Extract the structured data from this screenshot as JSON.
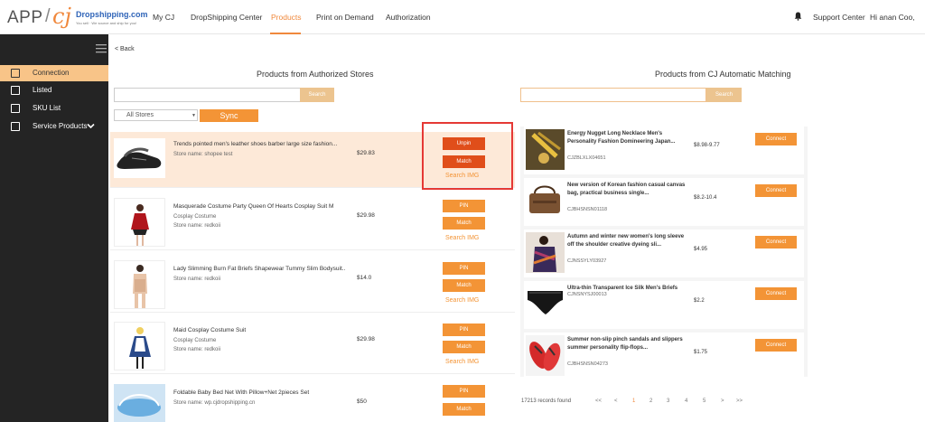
{
  "logo": {
    "app": "APP",
    "slash": "/",
    "cj": "cj",
    "brand": "Dropshipping.com",
    "tagline": "You sell · We source and ship for you!"
  },
  "nav": {
    "items": [
      "My CJ",
      "DropShipping Center",
      "Products",
      "Print on Demand",
      "Authorization"
    ],
    "support": "Support Center",
    "greeting": "Hi anan Coo,"
  },
  "sidebar": {
    "items": [
      "Connection",
      "Listed",
      "SKU List",
      "Service Products"
    ]
  },
  "back": "< Back",
  "left": {
    "title": "Products from Authorized Stores",
    "search_placeholder": "",
    "search_label": "Search",
    "store_select": "All Stores",
    "sync_label": "Sync",
    "rows": [
      {
        "title": "Trends pointed men's leather shoes barber large size fashion...",
        "sub": "",
        "store": "Store name: shopee test",
        "price": "$29.83",
        "btn1": "Unpin",
        "btn2": "Match",
        "img": "Search IMG"
      },
      {
        "title": "Masquerade Costume Party Queen Of Hearts Cosplay Suit M",
        "sub": "Cosplay Costume",
        "store": "Store name: redkoii",
        "price": "$29.98",
        "btn1": "PIN",
        "btn2": "Match",
        "img": "Search IMG"
      },
      {
        "title": "Lady Slimming Burn Fat Briefs Shapewear Tummy Slim Bodysuit...",
        "sub": "",
        "store": "Store name: redkoii",
        "price": "$14.0",
        "btn1": "PIN",
        "btn2": "Match",
        "img": "Search IMG"
      },
      {
        "title": "Maid Cosplay Costume Suit",
        "sub": "Cosplay Costume",
        "store": "Store name: redkoii",
        "price": "$29.98",
        "btn1": "PIN",
        "btn2": "Match",
        "img": "Search IMG"
      },
      {
        "title": "Foldable Baby Bed Net With Pillow+Net 2pieces Set",
        "sub": "",
        "store": "Store name: wp.cjdropshipping.cn",
        "price": "$50",
        "btn1": "PIN",
        "btn2": "Match",
        "img": ""
      }
    ]
  },
  "right": {
    "title": "Products from CJ Automatic Matching",
    "search_placeholder": "",
    "search_label": "Search",
    "connect_label": "Connect",
    "rows": [
      {
        "title": "Energy Nugget Long Necklace Men's Personality Fashion Domineering Japan...",
        "sku": "CJZBLXLX04651",
        "price": "$8.98-9.77"
      },
      {
        "title": "New version of Korean fashion casual canvas bag, practical business single...",
        "sku": "CJBHSNSN01118",
        "price": "$8.2-10.4"
      },
      {
        "title": "Autumn and winter new women's long sleeve off the shoulder creative dyeing sli...",
        "sku": "CJNSSYLY03927",
        "price": "$4.95"
      },
      {
        "title": "Ultra-thin Transparent Ice Silk Men's Briefs",
        "sku": "CJNSNYSJ00013",
        "price": "$2.2"
      },
      {
        "title": "Summer non-slip pinch sandals and slippers summer personality flip-flops...",
        "sku": "CJBHSNSN04273",
        "price": "$1.75"
      }
    ],
    "records": "17213 records found",
    "pager": [
      "<<",
      "<",
      "1",
      "2",
      "3",
      "4",
      "5",
      ">",
      ">>"
    ]
  },
  "colors": {
    "accent": "#f39436",
    "unpin": "#e04e1a",
    "sidebar": "#242424",
    "highlight": "#fde9d8",
    "annotation": "#e53935"
  }
}
